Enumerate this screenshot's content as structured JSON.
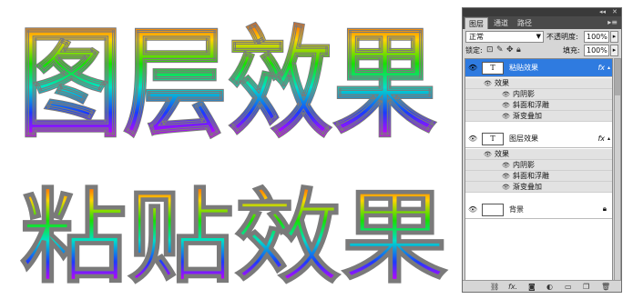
{
  "artwork": {
    "line1": "图层效果",
    "line2": "粘贴效果"
  },
  "panel": {
    "tabs": [
      {
        "label": "图层"
      },
      {
        "label": "通道"
      },
      {
        "label": "路径"
      }
    ],
    "blend_mode": "正常",
    "opacity_label": "不透明度:",
    "opacity_value": "100%",
    "lock_label": "锁定:",
    "fill_label": "填充:",
    "fill_value": "100%",
    "layers": [
      {
        "thumb": "T",
        "name": "粘贴效果",
        "selected": true,
        "fx": "fx",
        "effects_label": "效果",
        "effects": [
          "内阴影",
          "斜面和浮雕",
          "渐变叠加"
        ]
      },
      {
        "thumb": "T",
        "name": "图层效果",
        "selected": false,
        "fx": "fx",
        "effects_label": "效果",
        "effects": [
          "内阴影",
          "斜面和浮雕",
          "渐变叠加"
        ]
      },
      {
        "thumb": "",
        "name": "背景",
        "selected": false
      }
    ],
    "icons": {
      "eye": "eye-icon",
      "lock": "lock-icon",
      "bottom": [
        "link-icon",
        "fx-icon",
        "mask-icon",
        "adjustment-icon",
        "folder-icon",
        "new-layer-icon",
        "trash-icon"
      ]
    }
  }
}
